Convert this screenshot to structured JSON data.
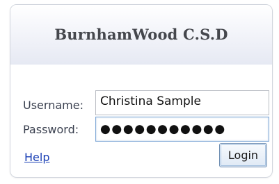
{
  "login_panel": {
    "title": "BurnhamWood C.S.D",
    "username": {
      "label": "Username:",
      "value": "Christina Sample"
    },
    "password": {
      "label": "Password:",
      "masked_value": "●●●●●●●●●●●"
    },
    "help_link": "Help",
    "login_button": "Login"
  }
}
